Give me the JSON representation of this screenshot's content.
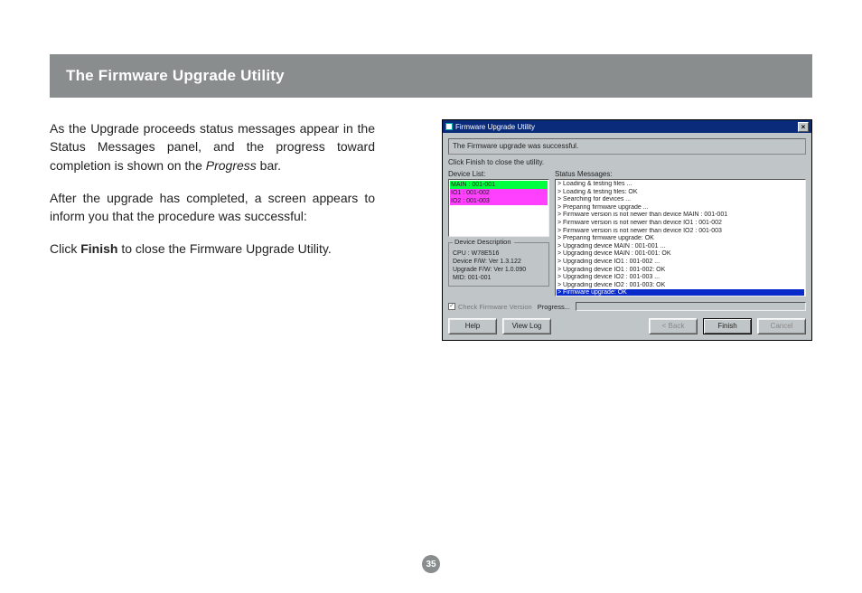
{
  "header": {
    "title": "The Firmware Upgrade Utility"
  },
  "page_number": "35",
  "body": {
    "p1_a": "As the Upgrade proceeds status messages appear in the Status Messages panel, and the progress toward completion is shown on the ",
    "p1_italic": "Progress",
    "p1_b": " bar.",
    "p2": "After the upgrade has completed, a screen appears to inform you that the procedure was successful:",
    "p3_a": "Click ",
    "p3_bold": "Finish",
    "p3_b": " to close the Firmware Upgrade Utility."
  },
  "dialog": {
    "title": "Firmware Upgrade Utility",
    "close_icon": "×",
    "success_msg": "The Firmware upgrade was successful.",
    "instruction": "Click Finish to close the utility.",
    "device_list_label": "Device List:",
    "status_label": "Status Messages:",
    "devices": [
      {
        "text": "MAIN : 001-001",
        "cls": "dev-main"
      },
      {
        "text": "IO1 : 001-002",
        "cls": "dev-io"
      },
      {
        "text": "IO2 : 001-003",
        "cls": "dev-io"
      }
    ],
    "messages": [
      "> Loading & testing files ...",
      "> Loading & testing files: OK",
      "> Searching for devices ...",
      "> Preparing firmware upgrade ...",
      "> Firmware version is not newer than device MAIN : 001-001",
      "> Firmware version is not newer than device IO1 : 001-002",
      "> Firmware version is not newer than device IO2 : 001-003",
      "> Preparing firmware upgrade: OK",
      "> Upgrading device MAIN : 001-001 ...",
      "> Upgrading device MAIN : 001-001: OK",
      "> Upgrading device IO1 : 001-002 ...",
      "> Upgrading device IO1 : 001-002: OK",
      "> Upgrading device IO2 : 001-003 ...",
      "> Upgrading device IO2 : 001-003: OK"
    ],
    "message_selected": "> Firmware upgrade: OK",
    "description": {
      "legend": "Device Description",
      "lines": [
        "CPU : W78E516",
        "Device F/W: Ver 1.3.122",
        "Upgrade F/W: Ver 1.0.090",
        "MID: 001-001"
      ]
    },
    "check_label": "Check Firmware Version",
    "progress_label": "Progress...",
    "buttons": {
      "help": "Help",
      "viewlog": "View Log",
      "back": "< Back",
      "finish": "Finish",
      "cancel": "Cancel"
    }
  }
}
